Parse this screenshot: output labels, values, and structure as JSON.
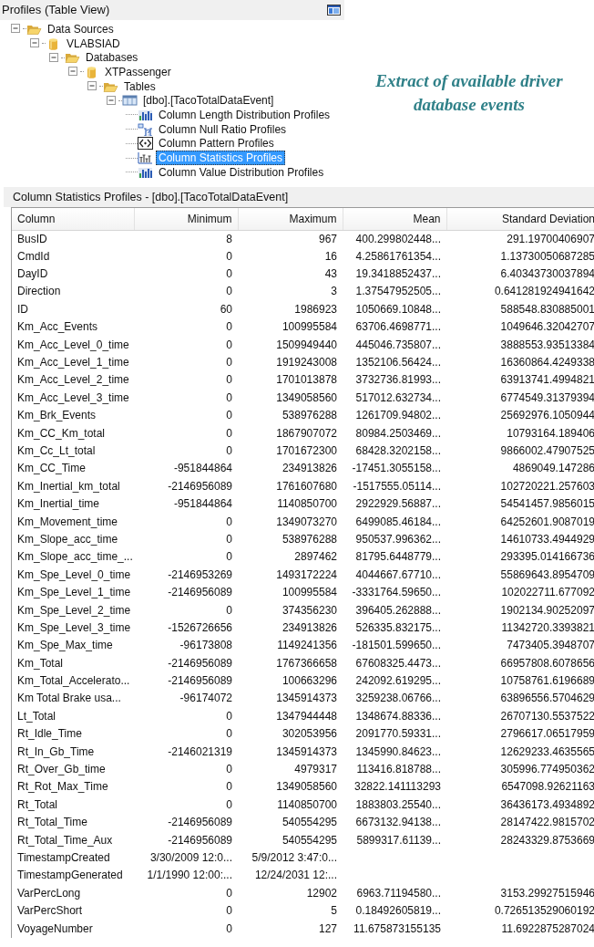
{
  "tree_panel": {
    "title": "Profiles (Table View)"
  },
  "tree": [
    {
      "label": "Data Sources",
      "kind": "folder",
      "expanded": true,
      "selected": false,
      "children": [
        {
          "label": "VLABSIAD",
          "kind": "database",
          "expanded": true,
          "selected": false,
          "children": [
            {
              "label": "Databases",
              "kind": "folder",
              "expanded": true,
              "selected": false,
              "children": [
                {
                  "label": "XTPassenger",
                  "kind": "database",
                  "expanded": true,
                  "selected": false,
                  "children": [
                    {
                      "label": "Tables",
                      "kind": "folder",
                      "expanded": true,
                      "selected": false,
                      "children": [
                        {
                          "label": "[dbo].[TacoTotalDataEvent]",
                          "kind": "table",
                          "expanded": true,
                          "selected": false,
                          "children": [
                            {
                              "label": "Column Length Distribution Profiles",
                              "kind": "distribution",
                              "selected": false
                            },
                            {
                              "label": "Column Null Ratio Profiles",
                              "kind": "null_ratio",
                              "selected": false
                            },
                            {
                              "label": "Column Pattern Profiles",
                              "kind": "pattern",
                              "selected": false
                            },
                            {
                              "label": "Column Statistics Profiles",
                              "kind": "statistics",
                              "selected": true
                            },
                            {
                              "label": "Column Value Distribution Profiles",
                              "kind": "distribution",
                              "selected": false
                            }
                          ]
                        }
                      ]
                    }
                  ]
                }
              ]
            }
          ]
        }
      ]
    }
  ],
  "callout": {
    "text": "Extract of available driver database events"
  },
  "results_panel": {
    "title": "Column Statistics Profiles  -  [dbo].[TacoTotalDataEvent]"
  },
  "table": {
    "columns": [
      "Column",
      "Minimum",
      "Maximum",
      "Mean",
      "Standard Deviation"
    ],
    "rows": [
      {
        "column": "BusID",
        "minimum": "8",
        "maximum": "967",
        "mean": "400.299802448...",
        "standard_deviation": "291.19700406907"
      },
      {
        "column": "CmdId",
        "minimum": "0",
        "maximum": "16",
        "mean": "4.25861761354...",
        "standard_deviation": "1.13730050687285"
      },
      {
        "column": "DayID",
        "minimum": "0",
        "maximum": "43",
        "mean": "19.3418852437...",
        "standard_deviation": "6.40343730037894"
      },
      {
        "column": "Direction",
        "minimum": "0",
        "maximum": "3",
        "mean": "1.37547952505...",
        "standard_deviation": "0.641281924941642"
      },
      {
        "column": "ID",
        "minimum": "60",
        "maximum": "1986923",
        "mean": "1050669.10848...",
        "standard_deviation": "588548.830885001"
      },
      {
        "column": "Km_Acc_Events",
        "minimum": "0",
        "maximum": "100995584",
        "mean": "63706.4698771...",
        "standard_deviation": "1049646.32042707"
      },
      {
        "column": "Km_Acc_Level_0_time",
        "minimum": "0",
        "maximum": "1509949440",
        "mean": "445046.735807...",
        "standard_deviation": "3888553.93513384"
      },
      {
        "column": "Km_Acc_Level_1_time",
        "minimum": "0",
        "maximum": "1919243008",
        "mean": "1352106.56424...",
        "standard_deviation": "16360864.4249338"
      },
      {
        "column": "Km_Acc_Level_2_time",
        "minimum": "0",
        "maximum": "1701013878",
        "mean": "3732736.81993...",
        "standard_deviation": "63913741.4994821"
      },
      {
        "column": "Km_Acc_Level_3_time",
        "minimum": "0",
        "maximum": "1349058560",
        "mean": "517012.632734...",
        "standard_deviation": "6774549.31379394"
      },
      {
        "column": "Km_Brk_Events",
        "minimum": "0",
        "maximum": "538976288",
        "mean": "1261709.94802...",
        "standard_deviation": "25692976.1050944"
      },
      {
        "column": "Km_CC_Km_total",
        "minimum": "0",
        "maximum": "1867907072",
        "mean": "80984.2503469...",
        "standard_deviation": "10793164.189406"
      },
      {
        "column": "Km_Cc_Lt_total",
        "minimum": "0",
        "maximum": "1701672300",
        "mean": "68428.3202158...",
        "standard_deviation": "9866002.47907525"
      },
      {
        "column": "Km_CC_Time",
        "minimum": "-951844864",
        "maximum": "234913826",
        "mean": "-17451.3055158...",
        "standard_deviation": "4869049.147286"
      },
      {
        "column": "Km_Inertial_km_total",
        "minimum": "-2146956089",
        "maximum": "1761607680",
        "mean": "-1517555.05114...",
        "standard_deviation": "102720221.257603"
      },
      {
        "column": "Km_Inertial_time",
        "minimum": "-951844864",
        "maximum": "1140850700",
        "mean": "2922929.56887...",
        "standard_deviation": "54541457.9856015"
      },
      {
        "column": "Km_Movement_time",
        "minimum": "0",
        "maximum": "1349073270",
        "mean": "6499085.46184...",
        "standard_deviation": "64252601.9087019"
      },
      {
        "column": "Km_Slope_acc_time",
        "minimum": "0",
        "maximum": "538976288",
        "mean": "950537.996362...",
        "standard_deviation": "14610733.4944929"
      },
      {
        "column": "Km_Slope_acc_time_...",
        "minimum": "0",
        "maximum": "2897462",
        "mean": "81795.6448779...",
        "standard_deviation": "293395.014166736"
      },
      {
        "column": "Km_Spe_Level_0_time",
        "minimum": "-2146953269",
        "maximum": "1493172224",
        "mean": "4044667.67710...",
        "standard_deviation": "55869643.8954709"
      },
      {
        "column": "Km_Spe_Level_1_time",
        "minimum": "-2146956089",
        "maximum": "100995584",
        "mean": "-3331764.59650...",
        "standard_deviation": "102022711.677092"
      },
      {
        "column": "Km_Spe_Level_2_time",
        "minimum": "0",
        "maximum": "374356230",
        "mean": "396405.262888...",
        "standard_deviation": "1902134.90252097"
      },
      {
        "column": "Km_Spe_Level_3_time",
        "minimum": "-1526726656",
        "maximum": "234913826",
        "mean": "526335.832175...",
        "standard_deviation": "11342720.3393821"
      },
      {
        "column": "Km_Spe_Max_time",
        "minimum": "-96173808",
        "maximum": "1149241356",
        "mean": "-181501.599650...",
        "standard_deviation": "7473405.3948707"
      },
      {
        "column": "Km_Total",
        "minimum": "-2146956089",
        "maximum": "1767366658",
        "mean": "67608325.4473...",
        "standard_deviation": "66957808.6078656"
      },
      {
        "column": "Km_Total_Accelerato...",
        "minimum": "-2146956089",
        "maximum": "100663296",
        "mean": "242092.619295...",
        "standard_deviation": "10758761.6196689"
      },
      {
        "column": "Km Total Brake usa...",
        "minimum": "-96174072",
        "maximum": "1345914373",
        "mean": "3259238.06766...",
        "standard_deviation": "63896556.5704629"
      },
      {
        "column": "Lt_Total",
        "minimum": "0",
        "maximum": "1347944448",
        "mean": "1348674.88336...",
        "standard_deviation": "26707130.5537522"
      },
      {
        "column": "Rt_Idle_Time",
        "minimum": "0",
        "maximum": "302053956",
        "mean": "2091770.59331...",
        "standard_deviation": "2796617.06517959"
      },
      {
        "column": "Rt_In_Gb_Time",
        "minimum": "-2146021319",
        "maximum": "1345914373",
        "mean": "1345990.84623...",
        "standard_deviation": "12629233.4635565"
      },
      {
        "column": "Rt_Over_Gb_time",
        "minimum": "0",
        "maximum": "4979317",
        "mean": "113416.818788...",
        "standard_deviation": "305996.774950362"
      },
      {
        "column": "Rt_Rot_Max_Time",
        "minimum": "0",
        "maximum": "1349058560",
        "mean": "32822.141113293",
        "standard_deviation": "6547098.92621163"
      },
      {
        "column": "Rt_Total",
        "minimum": "0",
        "maximum": "1140850700",
        "mean": "1883803.25540...",
        "standard_deviation": "36436173.4934892"
      },
      {
        "column": "Rt_Total_Time",
        "minimum": "-2146956089",
        "maximum": "540554295",
        "mean": "6673132.94138...",
        "standard_deviation": "28147422.9815702"
      },
      {
        "column": "Rt_Total_Time_Aux",
        "minimum": "-2146956089",
        "maximum": "540554295",
        "mean": "5899317.61139...",
        "standard_deviation": "28243329.8753669"
      },
      {
        "column": "TimestampCreated",
        "minimum": "3/30/2009 12:0...",
        "maximum": "5/9/2012 3:47:0..."
      },
      {
        "column": "TimestampGenerated",
        "minimum": "1/1/1990 12:00:...",
        "maximum": "12/24/2031 12:..."
      },
      {
        "column": "VarPercLong",
        "minimum": "0",
        "maximum": "12902",
        "mean": "6963.71194580...",
        "standard_deviation": "3153.29927515946"
      },
      {
        "column": "VarPercShort",
        "minimum": "0",
        "maximum": "5",
        "mean": "0.18492605819...",
        "standard_deviation": "0.726513529060192"
      },
      {
        "column": "VoyageNumber",
        "minimum": "0",
        "maximum": "127",
        "mean": "11.675873155135",
        "standard_deviation": "11.6922875287024"
      }
    ]
  }
}
